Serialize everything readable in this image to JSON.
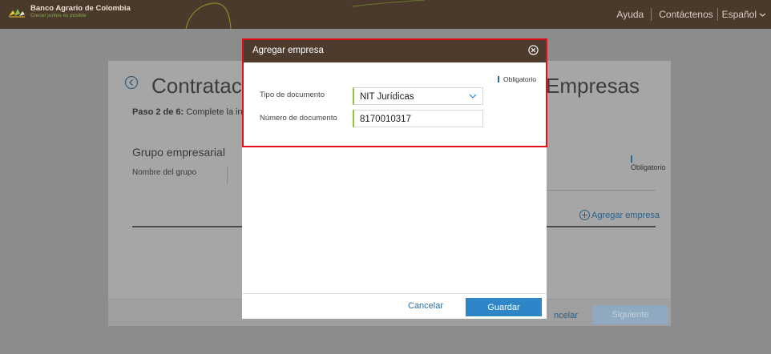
{
  "colors": {
    "topbar": "#4a3a2c",
    "modal_header": "#4d3b2d",
    "primary_button": "#2e86c9",
    "valid_field_accent": "#8cc63f",
    "highlight_border": "#e0101a"
  },
  "header": {
    "brand_name": "Banco Agrario de Colombia",
    "brand_tagline": "Crecer juntos es posible",
    "nav": {
      "help": "Ayuda",
      "contact": "Contáctenos",
      "language": "Español"
    }
  },
  "background_page": {
    "title_left": "Contratacio",
    "title_right": "Empresas",
    "step": {
      "prefix": "Paso 2 de 6:",
      "text": "Complete la info"
    },
    "section_title": "Grupo empresarial",
    "group_name_label": "Nombre del grupo",
    "required_note": "Obligatorio",
    "add_company": "Agregar empresa",
    "cancel": "ncelar",
    "next": "Siguiente"
  },
  "modal": {
    "title": "Agregar empresa",
    "required_note": "Obligatorio",
    "document_type_label": "Tipo de documento",
    "document_type_value": "NIT Jurídicas",
    "document_number_label": "Número de documento",
    "document_number_value": "8170010317",
    "cancel": "Cancelar",
    "save": "Guardar"
  },
  "icons": {
    "logo": "bank-logo-icon",
    "back": "back-arrow-icon",
    "close": "close-circle-icon",
    "chevron": "chevron-down-icon",
    "add": "plus-circle-icon"
  }
}
